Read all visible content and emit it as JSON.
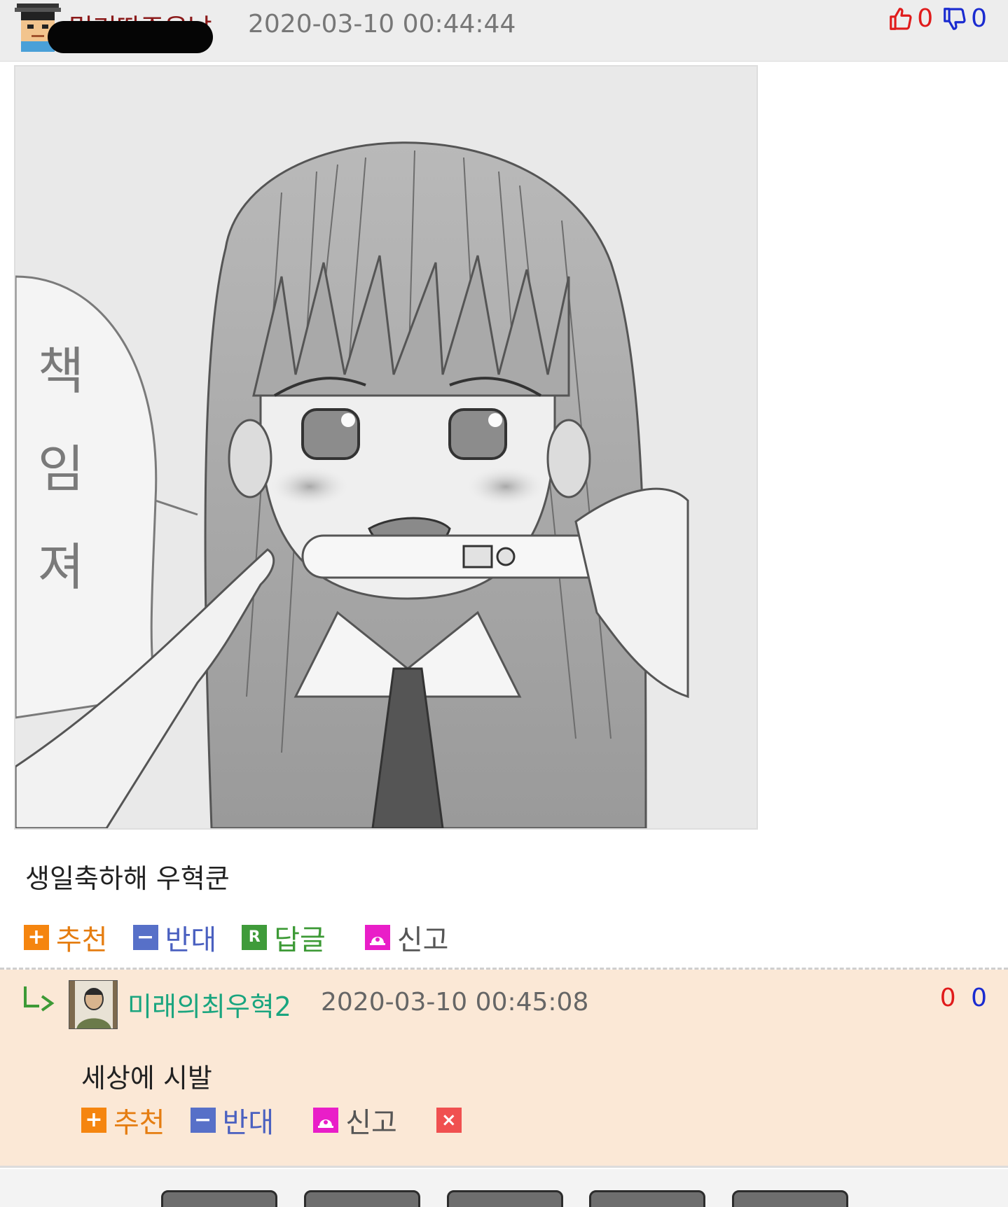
{
  "comment": {
    "nickname": "멀기딴주운날",
    "timestamp": "2020-03-10 00:44:44",
    "upvotes": "0",
    "downvotes": "0",
    "image_speech_text": [
      "책",
      "임",
      "져"
    ],
    "body": "생일축하해 우혁쿤",
    "actions": {
      "recommend": "추천",
      "oppose": "반대",
      "reply": "답글",
      "report": "신고"
    }
  },
  "reply": {
    "nickname": "미래의최우혁2",
    "timestamp": "2020-03-10 00:45:08",
    "upvotes": "0",
    "downvotes": "0",
    "body": "세상에 시발",
    "actions": {
      "recommend": "추천",
      "oppose": "반대",
      "report": "신고"
    }
  },
  "icons": {
    "plus": "+",
    "minus": "−",
    "reply_badge": "R",
    "delete": "×"
  },
  "colors": {
    "upvote": "#e01b1b",
    "downvote": "#1a2bd0",
    "recommend": "#f5850f",
    "oppose": "#5770c8",
    "reply": "#3f9b3a",
    "report": "#e91ec8",
    "reply_bg": "#fbe8d6",
    "reply_nick": "#1aa57f"
  }
}
